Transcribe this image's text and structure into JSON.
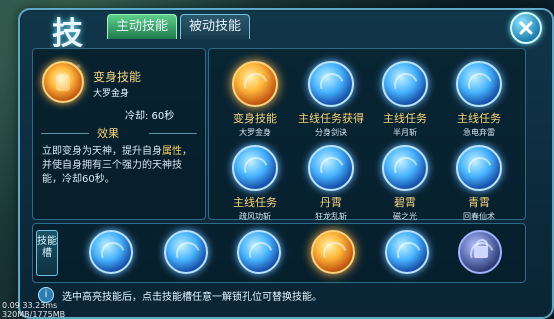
{
  "window": {
    "title": "技能"
  },
  "tabs": [
    {
      "label": "主动技能",
      "active": true
    },
    {
      "label": "被动技能",
      "active": false
    }
  ],
  "selected": {
    "name": "变身技能",
    "form": "大罗金身",
    "cooldown": "冷却: 60秒",
    "effect_title": "效果",
    "description": [
      {
        "text": "立即变身为天神，提升自身",
        "highlight": false
      },
      {
        "text": "属性",
        "highlight": true
      },
      {
        "text": "，并使自身拥有三个强力的天神技能，冷却60秒。",
        "highlight": false
      }
    ]
  },
  "skills": [
    {
      "title": "变身技能",
      "sub": "大罗金身",
      "style": "gold"
    },
    {
      "title": "主线任务获得",
      "sub": "分身剑诀",
      "style": "blue"
    },
    {
      "title": "主线任务",
      "sub": "半月斩",
      "style": "blue"
    },
    {
      "title": "主线任务",
      "sub": "急电弃雷",
      "style": "blue"
    },
    {
      "title": "主线任务",
      "sub": "疏风功斩",
      "style": "blue"
    },
    {
      "title": "丹霄",
      "sub": "狂龙乱斩",
      "style": "blue"
    },
    {
      "title": "碧霄",
      "sub": "磁之光",
      "style": "blue"
    },
    {
      "title": "青霄",
      "sub": "回春仙术",
      "style": "blue"
    }
  ],
  "slot_bar": {
    "label": "技能槽",
    "slots": [
      {
        "style": "blue"
      },
      {
        "style": "blue"
      },
      {
        "style": "blue"
      },
      {
        "style": "gold"
      },
      {
        "style": "blue"
      },
      {
        "style": "locked"
      }
    ]
  },
  "hint": "选中高亮技能后，点击技能槽任意一解锁孔位可替换技能。",
  "debug": {
    "line1": "0.09   33.23ms",
    "line2": "320MB/1775MB"
  }
}
